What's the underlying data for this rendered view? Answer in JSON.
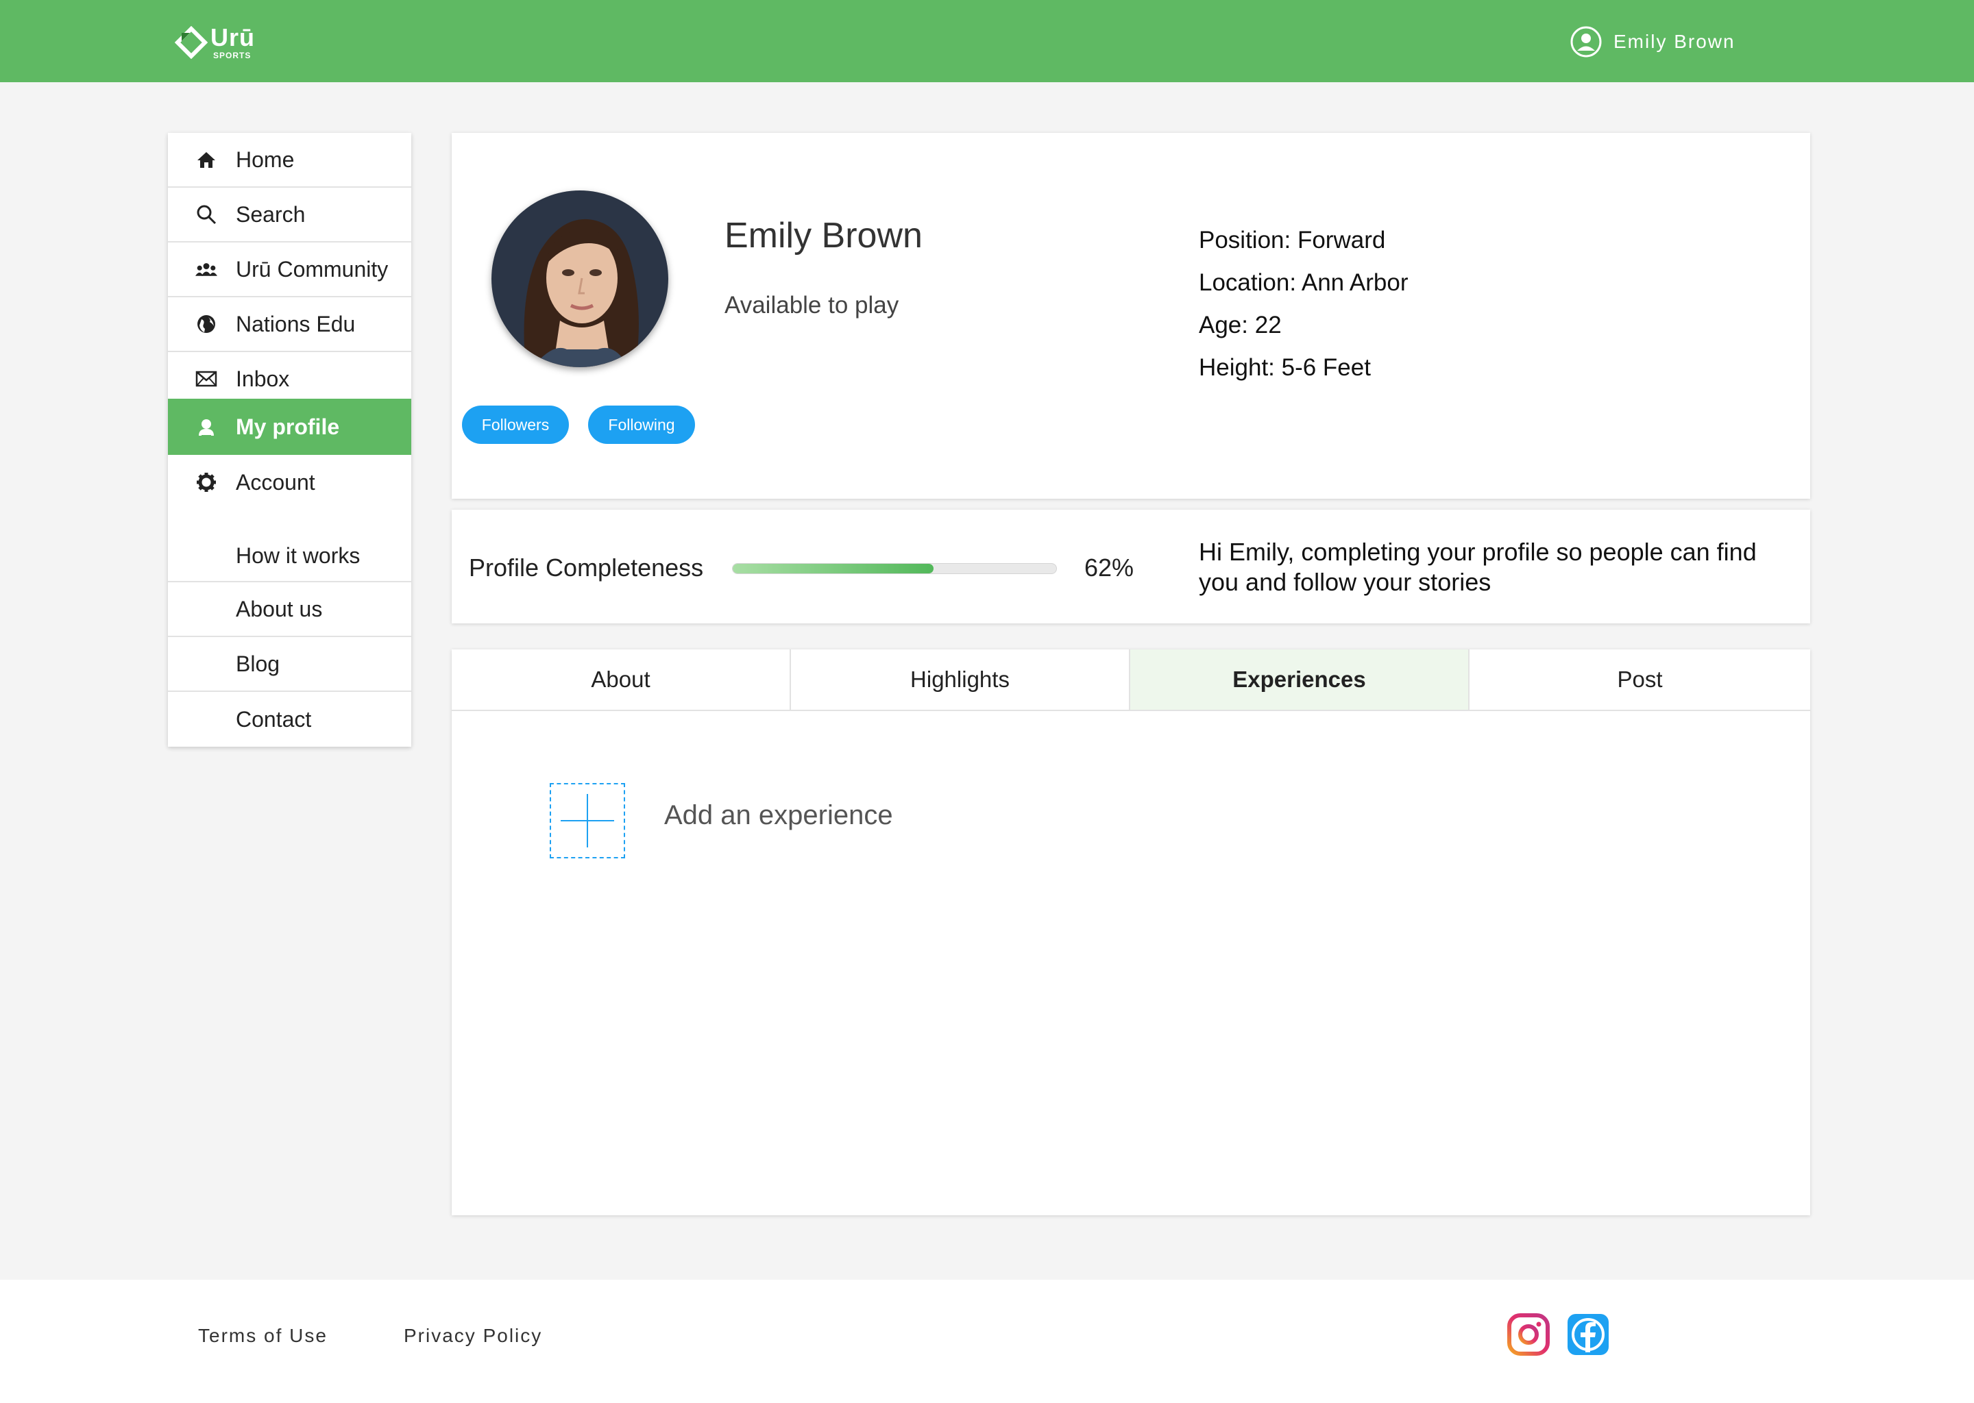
{
  "header": {
    "logo_text": "Urū",
    "logo_sub": "SPORTS",
    "user_name": "Emily Brown"
  },
  "sidebar": {
    "items": [
      {
        "label": "Home",
        "icon": "home-icon"
      },
      {
        "label": "Search",
        "icon": "search-icon"
      },
      {
        "label": "Urū Community",
        "icon": "community-icon"
      },
      {
        "label": "Nations Edu",
        "icon": "globe-icon"
      },
      {
        "label": "Inbox",
        "icon": "envelope-icon"
      },
      {
        "label": "My profile",
        "icon": "user-icon",
        "active": true
      },
      {
        "label": "Account",
        "icon": "gear-icon"
      },
      {
        "label": "How it works"
      },
      {
        "label": "About us"
      },
      {
        "label": "Blog"
      },
      {
        "label": "Contact"
      }
    ]
  },
  "profile": {
    "name": "Emily Brown",
    "status": "Available to play",
    "followers_label": "Followers",
    "following_label": "Following",
    "facts": [
      "Position: Forward",
      "Location: Ann Arbor",
      "Age: 22",
      "Height: 5-6 Feet"
    ]
  },
  "completeness": {
    "label": "Profile Completeness",
    "percent_text": "62%",
    "progress": 0.62,
    "message": "Hi Emily, completing your profile so people can find you and follow your stories"
  },
  "tabs": [
    {
      "label": "About"
    },
    {
      "label": "Highlights"
    },
    {
      "label": "Experiences",
      "active": true
    },
    {
      "label": "Post"
    }
  ],
  "experiences": {
    "add_label": "Add an experience"
  },
  "footer": {
    "terms": "Terms of Use",
    "privacy": "Privacy Policy",
    "social_icons": [
      "instagram-icon",
      "facebook-icon"
    ]
  },
  "colors": {
    "brand_green": "#5fb963",
    "accent_blue": "#1da1f2",
    "active_tab_bg": "#eef7ec"
  }
}
